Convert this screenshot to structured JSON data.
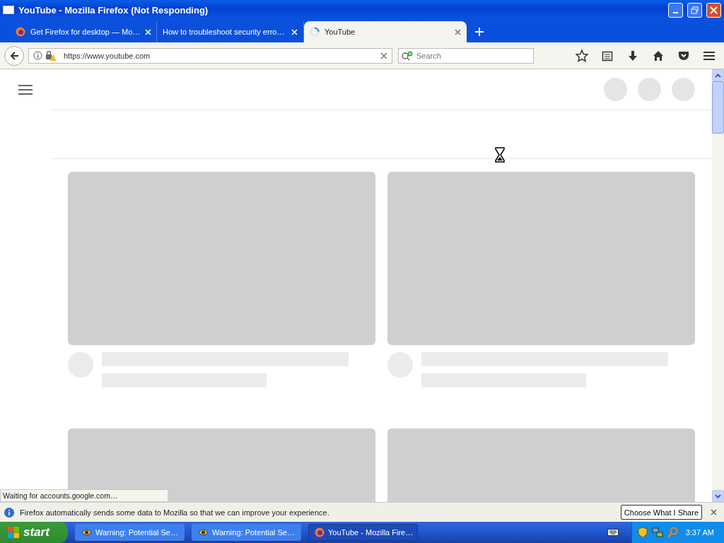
{
  "window": {
    "title": "YouTube - Mozilla Firefox (Not Responding)"
  },
  "tabs": [
    {
      "label": "Get Firefox for desktop — Mo…",
      "selected": false,
      "kind": "firefox"
    },
    {
      "label": "How to troubleshoot security erro…",
      "selected": false,
      "kind": "plain"
    },
    {
      "label": "YouTube",
      "selected": true,
      "kind": "loading"
    }
  ],
  "address_bar": {
    "value": "https://www.youtube.com"
  },
  "search": {
    "placeholder": "Search"
  },
  "status": "Waiting for accounts.google.com…",
  "notification": {
    "message": "Firefox automatically sends some data to Mozilla so that we can improve your experience.",
    "button": "Choose What I Share"
  },
  "taskbar": {
    "start": "start",
    "items": [
      {
        "label": "Warning: Potential Se…",
        "selected": false,
        "kind": "warning"
      },
      {
        "label": "Warning: Potential Se…",
        "selected": false,
        "kind": "warning"
      },
      {
        "label": "YouTube - Mozilla Fire…",
        "selected": true,
        "kind": "firefox"
      }
    ],
    "clock": "3:37 AM"
  }
}
